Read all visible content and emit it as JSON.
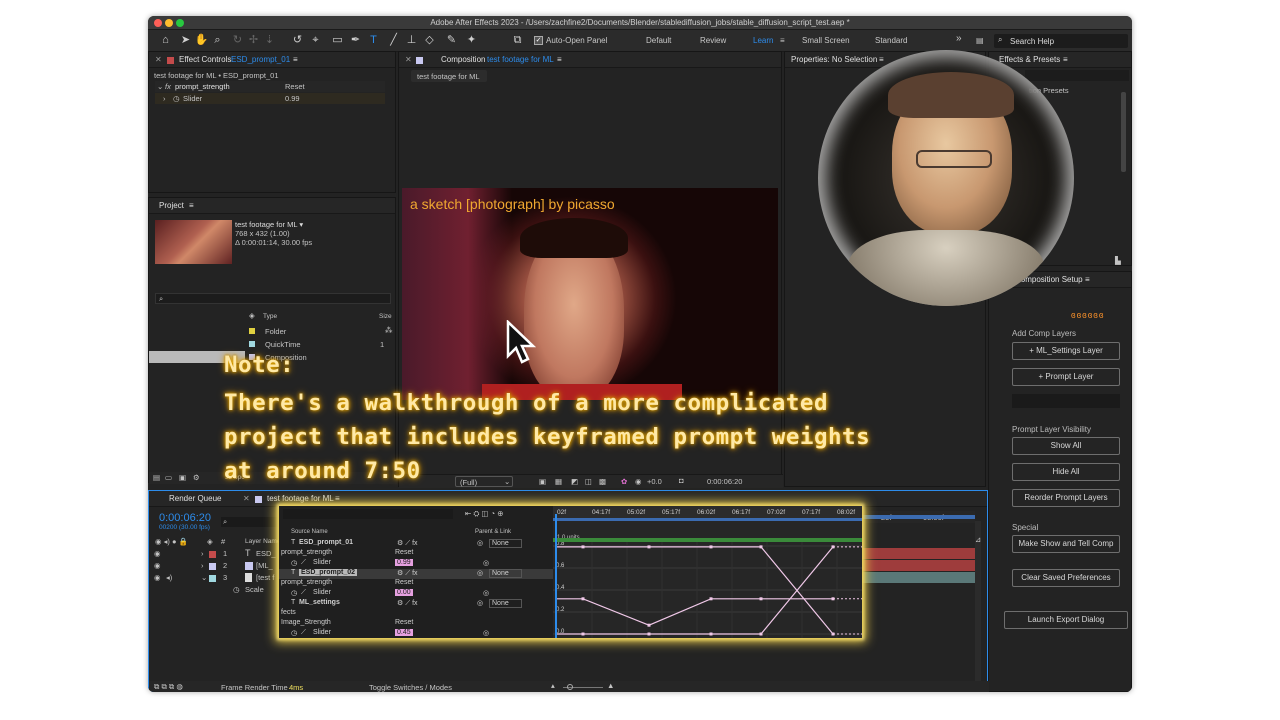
{
  "window": {
    "title": "Adobe After Effects 2023 - /Users/zachfine2/Documents/Blender/stablediffusion_jobs/stable_diffusion_script_test.aep *"
  },
  "toolbar": {
    "auto_open_panel": "Auto-Open Panel",
    "workspaces": [
      "Default",
      "Review",
      "Learn",
      "Small Screen",
      "Standard"
    ],
    "active_workspace": "Learn",
    "search_help": "Search Help"
  },
  "effect_controls": {
    "tab_label": "Effect Controls",
    "tab_target": "ESD_prompt_01",
    "path": "test footage for ML • ESD_prompt_01",
    "effect_name": "prompt_strength",
    "reset": "Reset",
    "slider_label": "Slider",
    "slider_value": "0.99"
  },
  "project": {
    "tab_label": "Project",
    "footage_name": "test footage for ML ▾",
    "footage_dims": "768 x 432 (1.00)",
    "footage_duration": "Δ 0:00:01:14, 30.00 fps",
    "col_type": "Type",
    "col_size": "Size",
    "items": [
      {
        "type": "Folder",
        "size": ""
      },
      {
        "type": "QuickTime",
        "size": "1"
      },
      {
        "type": "Composition",
        "size": ""
      }
    ],
    "bpc": "32 bpc"
  },
  "composition": {
    "tab_label": "Composition",
    "tab_target": "test footage for ML",
    "subtab": "test footage for ML",
    "overlay_text": "a sketch [photograph] by picasso",
    "resolution": "(Full)",
    "exposure": "+0.0",
    "timecode": "0:00:06:20"
  },
  "properties": {
    "title": "Properties: No Selection"
  },
  "effects_presets": {
    "title": "Effects & Presets",
    "item": "tion Presets"
  },
  "comp_setup": {
    "title": "Composition Setup",
    "add_comp_layers": "Add Comp Layers",
    "ml_settings_btn": "+ ML_Settings Layer",
    "prompt_layer_btn": "+ Prompt Layer",
    "visibility_title": "Prompt Layer Visibility",
    "show_all": "Show All",
    "hide_all": "Hide All",
    "reorder": "Reorder Prompt Layers",
    "special": "Special",
    "make_show": "Make Show and Tell Comp",
    "clear_prefs": "Clear Saved Preferences",
    "launch_export": "Launch Export Dialog"
  },
  "timeline": {
    "render_queue_tab": "Render Queue",
    "comp_tab": "test footage for ML",
    "timecode": "0:00:06:20",
    "fps": "00200 (30.00 fps)",
    "layer_col": "Layer Name",
    "layers": [
      {
        "num": "1",
        "name": "ESD_",
        "color": "#c44b4b"
      },
      {
        "num": "2",
        "name": "[ML_",
        "color": "#c8c8f0"
      },
      {
        "num": "3",
        "name": "[test f",
        "color": "#a0d8e0"
      }
    ],
    "scale_label": "Scale",
    "ruler_right": [
      "25f",
      "08:00f"
    ],
    "frame_render_label": "Frame Render Time",
    "frame_render_value": "4ms",
    "toggle_label": "Toggle Switches / Modes"
  },
  "inset": {
    "source_name": "Source Name",
    "parent_link": "Parent & Link",
    "rows": [
      {
        "kind": "layer",
        "label": "ESD_prompt_01",
        "parent": "None"
      },
      {
        "kind": "group",
        "label": "prompt_strength",
        "reset": "Reset"
      },
      {
        "kind": "prop",
        "label": "Slider",
        "value": "0.99"
      },
      {
        "kind": "layer",
        "label": "ESD_prompt_02",
        "parent": "None"
      },
      {
        "kind": "group",
        "label": "prompt_strength",
        "reset": "Reset"
      },
      {
        "kind": "prop",
        "label": "Slider",
        "value": "0.00"
      },
      {
        "kind": "layer",
        "label": "ML_settings",
        "parent": "None"
      },
      {
        "kind": "group",
        "label": "fects",
        "reset": ""
      },
      {
        "kind": "group",
        "label": "Image_Strength",
        "reset": "Reset"
      },
      {
        "kind": "prop",
        "label": "Slider",
        "value": "0.45"
      }
    ],
    "graph_ticks": [
      "02f",
      "04:17f",
      "05:02f",
      "05:17f",
      "06:02f",
      "06:17f",
      "07:02f",
      "07:17f",
      "08:02f"
    ],
    "units_label": "1.0 units",
    "y_labels": [
      "0.8",
      "0.6",
      "0.4",
      "0.2",
      "0.0"
    ],
    "graph_data": {
      "x_keys": [
        "04:02f",
        "04:17f",
        "05:17f",
        "06:17f",
        "07:02f",
        "07:17f"
      ],
      "series": [
        {
          "values": [
            0.99,
            0.99,
            0.99,
            0.99,
            0.99,
            0.0
          ],
          "color": "#f0c8e8"
        },
        {
          "values": [
            0.0,
            0.0,
            0.0,
            0.0,
            0.0,
            0.99
          ],
          "color": "#f0c8e8"
        },
        {
          "values": [
            0.4,
            0.4,
            0.1,
            0.4,
            0.4,
            0.4
          ],
          "color": "#f0c8e8"
        }
      ]
    }
  },
  "note": {
    "heading": "Note:",
    "lines": [
      "There's a walkthrough of a more complicated",
      "project that includes keyframed prompt weights",
      "at around 7:50"
    ]
  },
  "colors": {
    "accent": "#2d8ceb",
    "note_glow": "#f5b400",
    "highlight_row": "#b9b9b9"
  }
}
